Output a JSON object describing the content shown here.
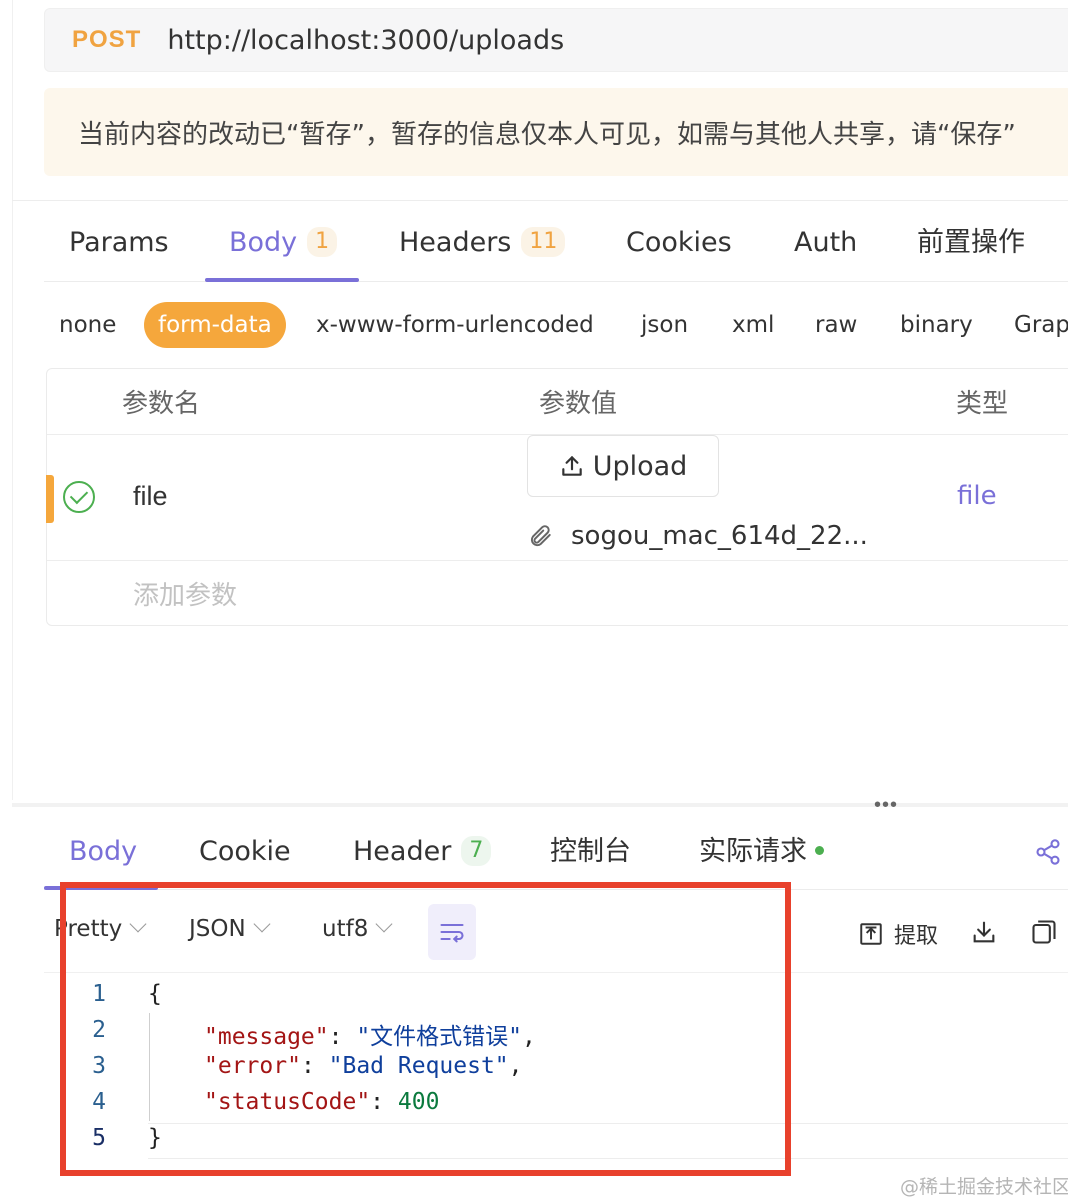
{
  "request": {
    "method": "POST",
    "url": "http://localhost:3000/uploads"
  },
  "notice": "当前内容的改动已“暂存”，暂存的信息仅本人可见，如需与其他人共享，请“保存”",
  "request_tabs": [
    {
      "label": "Params",
      "badge": ""
    },
    {
      "label": "Body",
      "badge": "1"
    },
    {
      "label": "Headers",
      "badge": "11"
    },
    {
      "label": "Cookies",
      "badge": ""
    },
    {
      "label": "Auth",
      "badge": ""
    },
    {
      "label": "前置操作",
      "badge": ""
    }
  ],
  "active_request_tab": "Body",
  "body_types": [
    "none",
    "form-data",
    "x-www-form-urlencoded",
    "json",
    "xml",
    "raw",
    "binary",
    "GraphQL"
  ],
  "active_body_type": "form-data",
  "params_table": {
    "headers": [
      "参数名",
      "参数值",
      "类型"
    ],
    "rows": [
      {
        "enabled": true,
        "name": "file",
        "upload_label": "Upload",
        "file_name": "sogou_mac_614d_22...",
        "type": "file"
      }
    ],
    "add_placeholder": "添加参数"
  },
  "response_tabs": [
    {
      "label": "Body",
      "badge": ""
    },
    {
      "label": "Cookie",
      "badge": ""
    },
    {
      "label": "Header",
      "badge": "7"
    },
    {
      "label": "控制台",
      "badge": ""
    },
    {
      "label": "实际请求",
      "badge": ""
    }
  ],
  "active_response_tab": "Body",
  "response_toolbar": {
    "view_mode": "Pretty",
    "format": "JSON",
    "encoding": "utf8",
    "extract_label": "提取"
  },
  "response_body": {
    "line_numbers": [
      "1",
      "2",
      "3",
      "4",
      "5"
    ],
    "open_brace": "{",
    "close_brace": "}",
    "fields": [
      {
        "key": "\"message\"",
        "value": "\"文件格式错误\"",
        "value_type": "string"
      },
      {
        "key": "\"error\"",
        "value": "\"Bad Request\"",
        "value_type": "string"
      },
      {
        "key": "\"statusCode\"",
        "value": "400",
        "value_type": "number"
      }
    ]
  },
  "watermark": "@稀土掘金技术社区",
  "colors": {
    "accent": "#7a70d8",
    "method": "#f0a341",
    "form_data_pill": "#f5a73c",
    "annotation_box": "#e8412c",
    "status_dot": "#4caf50"
  },
  "icons": [
    "upload-icon",
    "paperclip-icon",
    "check-circle-icon",
    "share-icon",
    "wrap-lines-icon",
    "extract-icon",
    "download-icon",
    "copy-icon"
  ]
}
